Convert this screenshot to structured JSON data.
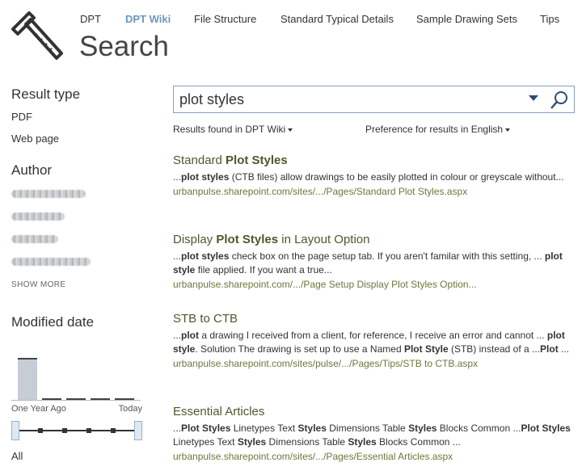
{
  "nav": {
    "items": [
      "DPT",
      "DPT Wiki",
      "File Structure",
      "Standard Typical Details",
      "Sample Drawing Sets",
      "Tips"
    ],
    "active_index": 1
  },
  "page_title": "Search",
  "sidebar": {
    "result_type": {
      "heading": "Result type",
      "items": [
        "PDF",
        "Web page"
      ]
    },
    "author": {
      "heading": "Author",
      "show_more": "SHOW MORE"
    },
    "modified_date": {
      "heading": "Modified date",
      "start_label": "One Year Ago",
      "end_label": "Today",
      "filter_value": "All"
    }
  },
  "search": {
    "query": "plot styles"
  },
  "results_found": "Results found in DPT Wiki",
  "preference": "Preference for results in English",
  "results": [
    {
      "title_plain": "Standard ",
      "title_bold": "Plot Styles",
      "title_rest": "",
      "snippet": "...<b>plot styles</b> (CTB files) allow drawings to be easily plotted in colour or greyscale without...",
      "url": "urbanpulse.sharepoint.com/sites/.../Pages/Standard Plot Styles.aspx"
    },
    {
      "title_plain": "Display ",
      "title_bold": "Plot Styles",
      "title_rest": " in Layout Option",
      "snippet": "...<b>plot styles</b> check box on the page setup tab. If you aren't familar with this setting, ... <b>plot style</b> file applied. If you want a true...",
      "url": "urbanpulse.sharepoint.com/.../Page Setup Display Plot Styles Option..."
    },
    {
      "title_plain": "STB to CTB",
      "title_bold": "",
      "title_rest": "",
      "snippet": "...<b>plot</b> a drawing I received from a client, for reference, I receive an error and cannot ... <b>plot style</b>. Solution The drawing is set up to use a Named <b>Plot Style</b> (STB) instead of a ...<b>Plot</b> ...",
      "url": "urbanpulse.sharepoint.com/sites/pulse/.../Pages/Tips/STB to CTB.aspx"
    },
    {
      "title_plain": "Essential Articles",
      "title_bold": "",
      "title_rest": "",
      "snippet": "...<b>Plot Styles</b> Linetypes Text <b>Styles</b> Dimensions Table <b>Styles</b> Blocks Common ...<b>Plot Styles</b> Linetypes Text <b>Styles</b> Dimensions Table <b>Styles</b> Blocks Common ...",
      "url": "urbanpulse.sharepoint.com/sites/.../Pages/Essential Articles.aspx"
    }
  ],
  "histogram": {
    "counts_relative": [
      1.0,
      0.04,
      0.04,
      0.04,
      0.04
    ]
  },
  "icons": {
    "logo": "t-square-logo-icon",
    "search": "search-icon",
    "dropdown": "chevron-down-icon"
  },
  "colors": {
    "accent": "#6a97c1",
    "result_title": "#4b5a2e",
    "result_url": "#687a3b",
    "search_border": "#8aa0b8"
  }
}
